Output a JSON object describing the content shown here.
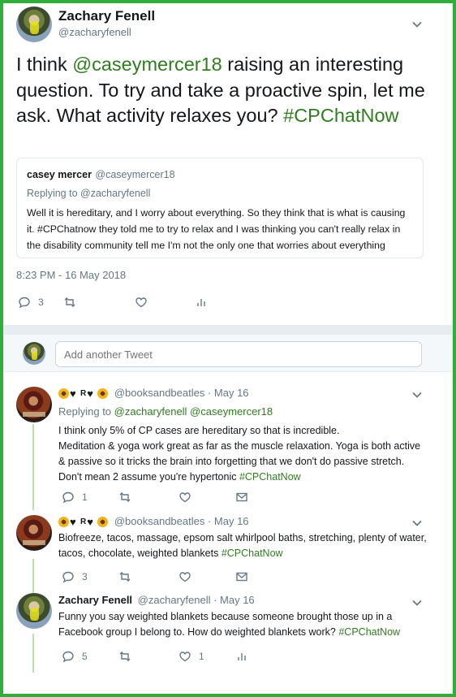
{
  "main_tweet": {
    "name": "Zachary Fenell",
    "handle": "@zacharyfenell",
    "text_before": "I think ",
    "mention": "@caseymercer18",
    "text_after": " raising an interesting question. To try and take a proactive spin, let me ask. What activity relaxes you? ",
    "hashtag": "#CPChatNow",
    "timestamp": "8:23 PM - 16 May 2018",
    "reply_count": "3",
    "quote": {
      "name": "casey mercer",
      "handle": "@caseymercer18",
      "replying_to_label": "Replying to ",
      "replying_to_handle": "@zacharyfenell",
      "body": "Well it is hereditary, and I worry about everything. So they think that is what is causing it. #CPChatnow they told me to try to relax and I was thinking you can't really relax in the disability community tell me I'm not the only one that worries about everything"
    }
  },
  "compose": {
    "placeholder": "Add another Tweet"
  },
  "replies": [
    {
      "display_name_letters": "R",
      "handle_date": "@booksandbeatles · May 16",
      "replying_to_label": "Replying to ",
      "replying_to": "@zacharyfenell @caseymercer18",
      "body_lines": [
        "I think only 5% of CP cases are hereditary so that is incredible.",
        "Meditation & yoga work great as far as the muscle relaxation. Yoga is both active",
        "& passive so it tricks the brain into forgetting that we don't do passive stretch.",
        "Don't mean 2 assume you're hypertonic "
      ],
      "hashtag": "#CPChatNow",
      "reply_count": "1"
    },
    {
      "display_name_letters": "R",
      "handle_date": "@booksandbeatles · May 16",
      "body_lines": [
        "Biofreeze, tacos, massage, epsom salt whirlpool baths, stretching, plenty of water,",
        "tacos, chocolate, weighted blankets "
      ],
      "hashtag": "#CPChatNow",
      "reply_count": "3"
    },
    {
      "name": "Zachary Fenell",
      "handle_date": "@zacharyfenell · May 16",
      "body_lines": [
        "Funny you say weighted blankets because someone brought those up in a",
        "Facebook group I belong to. How do weighted blankets work? "
      ],
      "hashtag": "#CPChatNow",
      "reply_count": "5",
      "like_count": "1"
    }
  ],
  "colors": {
    "border_green": "#2fae3c",
    "link_green": "#2f7d1f",
    "muted": "#657786",
    "thread_line": "#b7e3a8"
  },
  "icons": [
    "chevron-down-icon",
    "reply-icon",
    "retweet-icon",
    "like-icon",
    "analytics-icon",
    "message-icon",
    "sunflower-emoji",
    "black-heart-emoji"
  ]
}
